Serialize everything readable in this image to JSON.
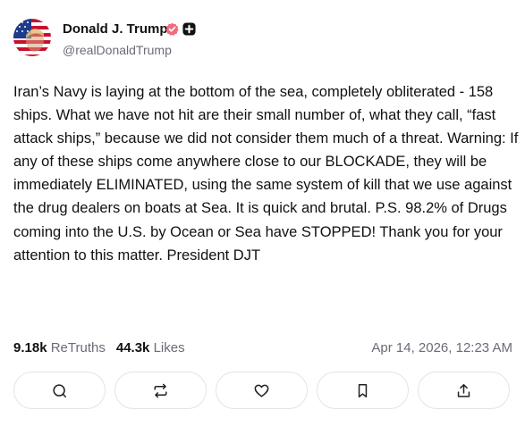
{
  "author": {
    "name": "Donald J. Trump",
    "handle": "@realDonaldTrump",
    "avatar_icon": "flag-portrait-avatar",
    "verified_badge_color": "#f06b7c",
    "plus_badge_color": "#111111"
  },
  "post": {
    "text": "Iran’s Navy is laying at the bottom of the sea, completely obliterated - 158 ships. What we have not hit are their small number of, what they call, “fast attack ships,” because we did not consider them much of a threat. Warning: If any of these ships come anywhere close to our BLOCKADE, they will be immediately ELIMINATED, using the same system of kill that we use against the drug dealers on boats at Sea. It is quick and brutal. P.S. 98.2% of Drugs coming into the U.S. by Ocean or Sea have STOPPED! Thank you for your attention to this matter. President DJT"
  },
  "stats": {
    "retruths_count": "9.18k",
    "retruths_label": "ReTruths",
    "likes_count": "44.3k",
    "likes_label": "Likes"
  },
  "timestamp": "Apr 14, 2026, 12:23 AM",
  "actions": [
    "reply-icon",
    "retruth-icon",
    "like-icon",
    "bookmark-icon",
    "share-icon"
  ],
  "colors": {
    "text": "#111111",
    "muted": "#6b6b78",
    "border": "#e3e3ea"
  }
}
